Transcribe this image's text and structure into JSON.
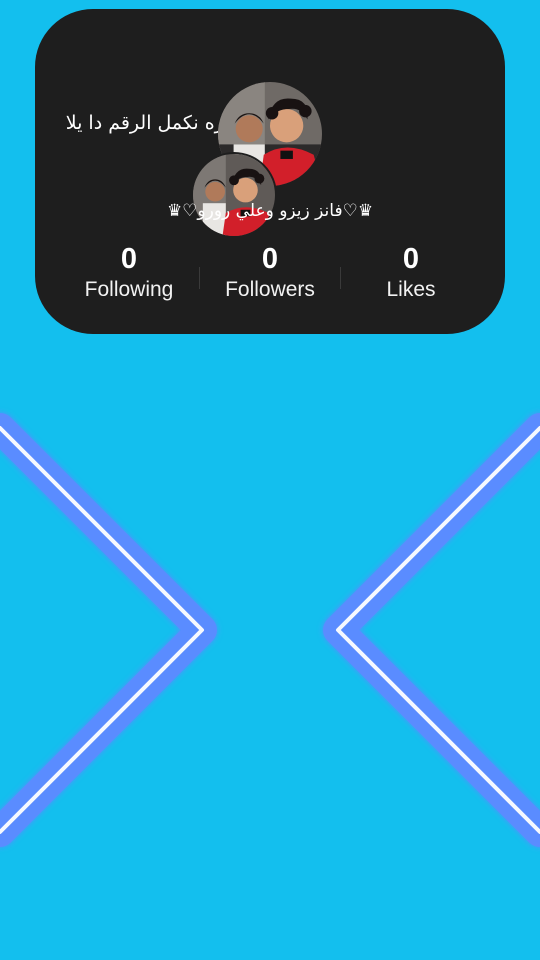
{
  "profile": {
    "caption": "عوزه نكمل الرقم دا يلا",
    "username": "♛♡فانز زيزو وعلي رورو♡♛",
    "avatar_large": "profile-photo",
    "avatar_small": "profile-photo-secondary"
  },
  "stats": [
    {
      "value": "0",
      "label": "Following"
    },
    {
      "value": "0",
      "label": "Followers"
    },
    {
      "value": "0",
      "label": "Likes"
    }
  ],
  "navigation": {
    "left_icon": "chevron-right-icon",
    "right_icon": "chevron-left-icon"
  },
  "colors": {
    "background": "#13bfee",
    "card": "#1e1e1e",
    "chevron_glow": "#5a8cff",
    "chevron_core": "#ffffff",
    "text": "#ffffff"
  }
}
